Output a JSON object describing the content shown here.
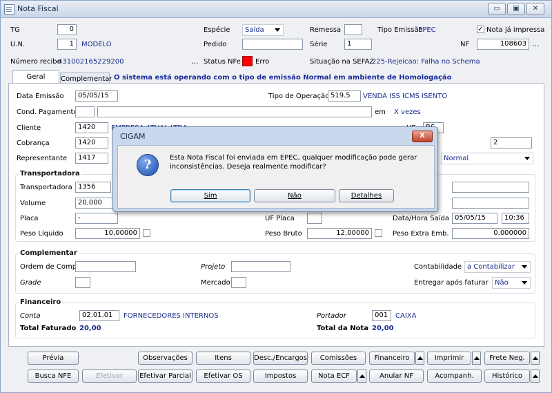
{
  "window": {
    "title": "Nota Fiscal",
    "minimize": "▭",
    "restore": "▣",
    "close": "✕"
  },
  "header": {
    "tg_label": "TG",
    "tg_value": "0",
    "un_label": "U.N.",
    "un_value": "1",
    "un_name": "MODELO",
    "especie_label": "Espécie",
    "especie_value": "Saída",
    "pedido_label": "Pedido",
    "pedido_value": "",
    "remessa_label": "Remessa",
    "remessa_value": "",
    "serie_label": "Série",
    "serie_value": "1",
    "tipo_emissao_label": "Tipo Emissão",
    "tipo_emissao_value": "EPEC",
    "nota_impressa_label": "Nota já impressa",
    "nota_impressa_checked": "✓",
    "nf_label": "NF",
    "nf_value": "108603",
    "recibo_label": "Número recibo",
    "recibo_value": "431002165229200",
    "status_label": "Status NFe",
    "status_value": "Erro",
    "status_color": "#ff0000",
    "situacao_label": "Situação na SEFAZ",
    "situacao_value": "225-Rejeicao: Falha no Schema",
    "dots": "..."
  },
  "tabs": {
    "geral": "Geral",
    "complementar": "Complementar"
  },
  "banner": "O sistema está operando com o tipo de emissão Normal em ambiente de Homologação",
  "geral": {
    "data_emissao_label": "Data Emissão",
    "data_emissao_value": "05/05/15",
    "tipo_operacao_label": "Tipo de Operação",
    "tipo_operacao_value": "519.5",
    "tipo_operacao_desc": "VENDA ISS ICMS ISENTO",
    "cond_pagamento_label": "Cond. Pagamento",
    "cond_code": "",
    "cond_desc": "",
    "em_label": "em",
    "vezes_label": "X vezes",
    "cliente_label": "Cliente",
    "cliente_value": "1420",
    "cobranca_label": "Cobrança",
    "cobranca_value": "1420",
    "cobranca_field2": "2",
    "representante_label": "Representante",
    "representante_value": "1417",
    "select_normal": "Normal"
  },
  "transportadora": {
    "title": "Transportadora",
    "transportadora_label": "Transportadora",
    "transportadora_value": "1356",
    "volume_label": "Volume",
    "volume_value": "20,000",
    "placa_label": "Placa",
    "placa_value": "-",
    "uf_placa_label": "UF Placa",
    "uf_placa_value": "",
    "data_saida_label": "Data/Hora Saída",
    "data_saida_value": "05/05/15",
    "hora_saida_value": "10:36",
    "peso_liquido_label": "Peso Líquido",
    "peso_liquido_value": "10,00000",
    "peso_bruto_label": "Peso Bruto",
    "peso_bruto_value": "12,00000",
    "peso_extra_label": "Peso Extra Emb.",
    "peso_extra_value": "0,000000"
  },
  "complementar": {
    "title": "Complementar",
    "ordem_compra_label": "Ordem de Compra",
    "ordem_compra_value": "",
    "projeto_label": "Projeto",
    "projeto_value": "",
    "contabilidade_label": "Contabilidade",
    "contabilidade_value": "a Contabilizar",
    "grade_label": "Grade",
    "grade_value": "",
    "mercado_label": "Mercado",
    "mercado_value": "",
    "entregar_label": "Entregar após faturar",
    "entregar_value": "Não"
  },
  "financeiro": {
    "title": "Financeiro",
    "conta_label": "Conta",
    "conta_value": "02.01.01",
    "conta_desc": "FORNECEDORES INTERNOS",
    "portador_label": "Portador",
    "portador_value": "001",
    "portador_desc": "CAIXA",
    "total_faturado_label": "Total Faturado",
    "total_faturado_value": "20,00",
    "total_nota_label": "Total da Nota",
    "total_nota_value": "20,00"
  },
  "buttons": {
    "previa": "Prévia",
    "observacoes": "Observações",
    "itens": "Itens",
    "desc_encargos": "Desc./Encargos",
    "comissoes": "Comissões",
    "financeiro": "Financeiro",
    "imprimir": "Imprimir",
    "frete_neg": "Frete Neg.",
    "busca_nfe": "Busca NFE",
    "efetivar": "Efetivar",
    "efetivar_parcial": "Efetivar Parcial",
    "efetivar_os": "Efetivar OS",
    "impostos": "Impostos",
    "nota_ecf": "Nota ECF",
    "anular_nf": "Anular NF",
    "acompanh": "Acompanh.",
    "historico": "Histórico"
  },
  "dialog": {
    "title": "CIGAM",
    "close": "X",
    "message_line1": "Esta Nota Fiscal foi enviada em EPEC, qualquer modificação pode gerar",
    "message_line2": "inconsistências. Deseja realmente modificar?",
    "btn_sim": "Sim",
    "btn_nao": "Não",
    "btn_detalhes": "Detalhes",
    "partial_cliente": "EMPRESA ATUAL LTDA",
    "partial_uf": "UF",
    "partial_uf_value": "RS"
  }
}
